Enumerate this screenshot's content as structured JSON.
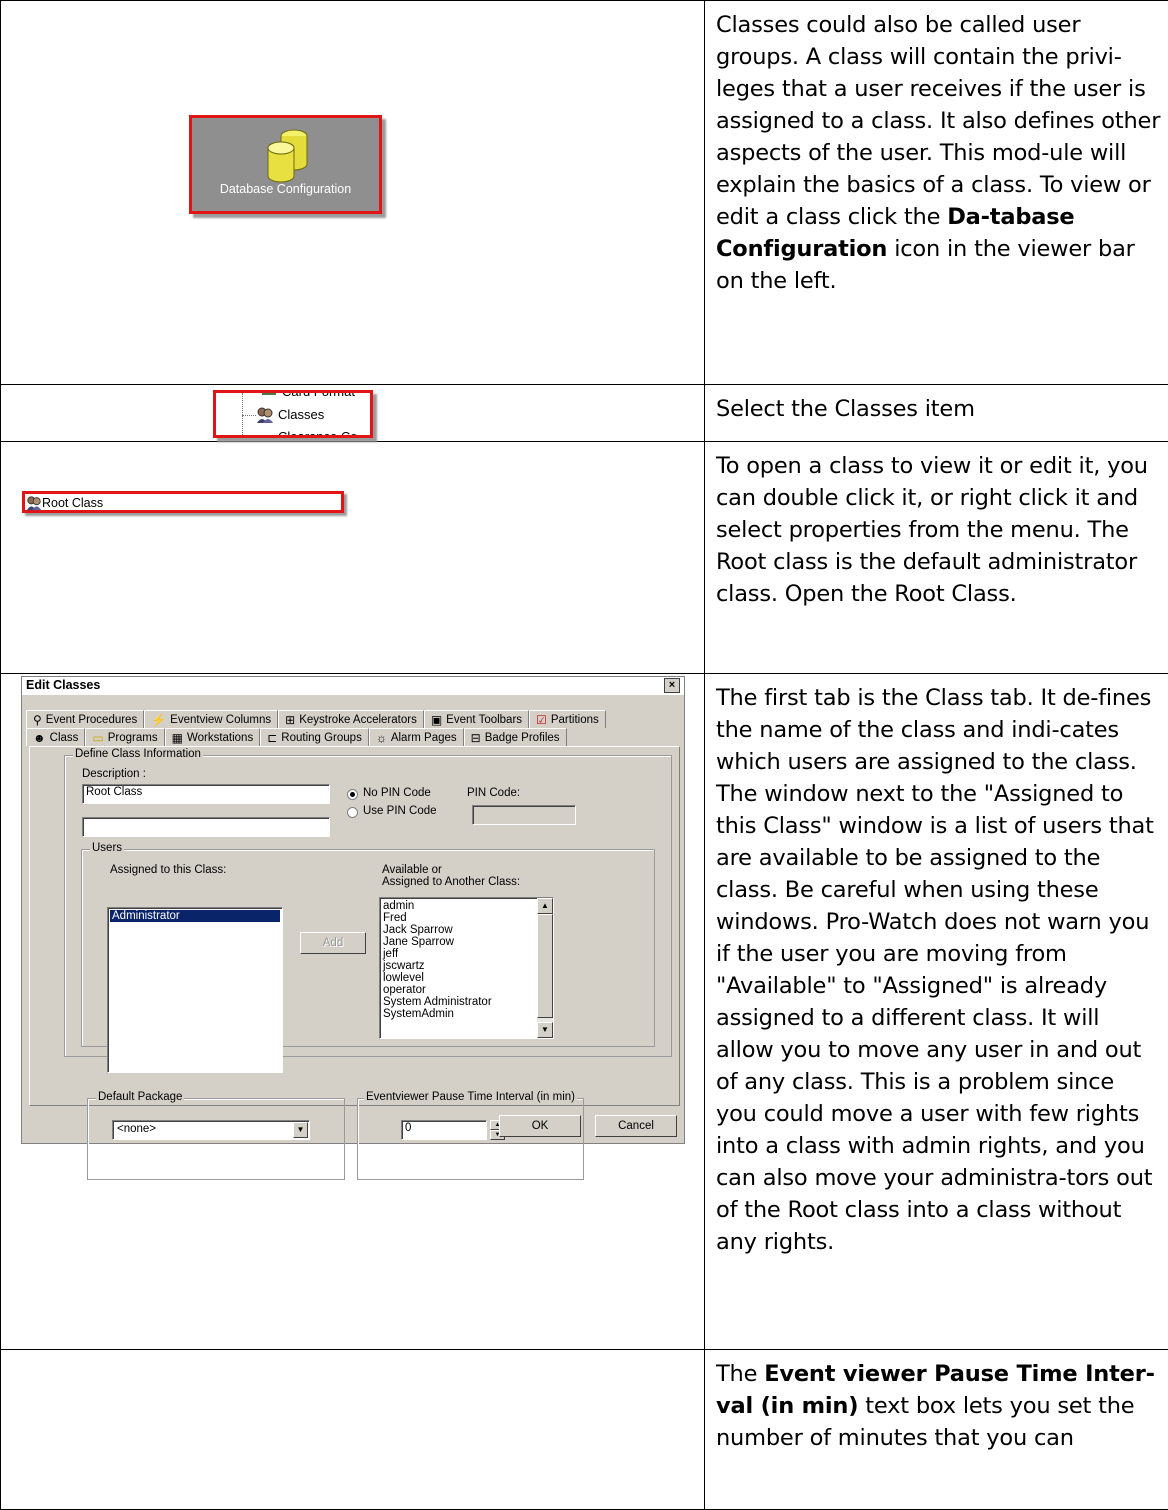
{
  "rows": [
    {
      "left": {
        "label": "Database Configuration"
      },
      "right": {
        "paragraph": "Classes could also be called user groups. A class will contain the privi-leges that a user receives if the user is assigned to a class. It also defines other aspects of the user. This mod-ule will explain the basics of a class. To view or edit a class click the ",
        "bold": "Da-tabase Configuration",
        "paragraph_end": " icon in the viewer bar on the left."
      }
    },
    {
      "left": {
        "top_item": "Card Format",
        "selected_item": "Classes",
        "bottom_item": "Clearance Co"
      },
      "right": {
        "paragraph": "Select the Classes item"
      }
    },
    {
      "left": {
        "label": "Root Class"
      },
      "right": {
        "paragraph": "To open a class to view it or edit it, you can double click it, or right click it and select properties from the menu. The Root class is the default administrator class. Open the Root Class."
      }
    },
    {
      "left": {
        "dialog": {
          "title": "Edit Classes",
          "close": "×",
          "tabs_row1": [
            "Event Procedures",
            "Eventview Columns",
            "Keystroke Accelerators",
            "Event Toolbars",
            "Partitions"
          ],
          "tabs_row2": [
            "Class",
            "Programs",
            "Workstations",
            "Routing Groups",
            "Alarm Pages",
            "Badge Profiles"
          ],
          "define_group": "Define Class Information",
          "description_label": "Description :",
          "description_value": "Root Class",
          "description_value2": "",
          "no_pin": "No PIN Code",
          "use_pin": "Use PIN Code",
          "pin_label": "PIN Code:",
          "users_group": "Users",
          "assigned_label": "Assigned to this Class:",
          "assigned_users": [
            "Administrator"
          ],
          "available_label1": "Available or",
          "available_label2": "Assigned to Another Class:",
          "available_users": [
            "admin",
            "Fred",
            "Jack Sparrow",
            "Jane Sparrow",
            "jeff",
            "jscwartz",
            "lowlevel",
            "operator",
            "System Administrator",
            "SystemAdmin"
          ],
          "add_button": "Add",
          "default_package_group": "Default Package",
          "default_package_value": "<none>",
          "pause_group": "Eventviewer Pause Time Interval (in min)",
          "pause_value": "0",
          "ok_button": "OK",
          "cancel_button": "Cancel"
        }
      },
      "right": {
        "paragraph": "The first tab is the Class tab. It de-fines the name of the class and indi-cates which users are assigned to the class. The window next to the \"Assigned to this Class\" window is a list of users that are available to be assigned to the class. Be careful when using these windows. Pro-Watch does not warn you if the user you are moving from \"Available\" to \"Assigned\" is already assigned to a different class. It will allow you to move any user in and out of any class. This is a problem since you could move a user with few rights into a class with admin rights, and you can also move your administra-tors out of the Root class into a class without any rights."
      }
    },
    {
      "right": {
        "bold": "Event viewer Pause Time Inter-val (in min)",
        "paragraph_end": " text box lets you set the number of minutes that you can",
        "lead": "The "
      }
    }
  ],
  "colors": {
    "highlight_border": "#e01515",
    "dialog_face": "#d4d0c8",
    "selection": "#0a246a"
  }
}
